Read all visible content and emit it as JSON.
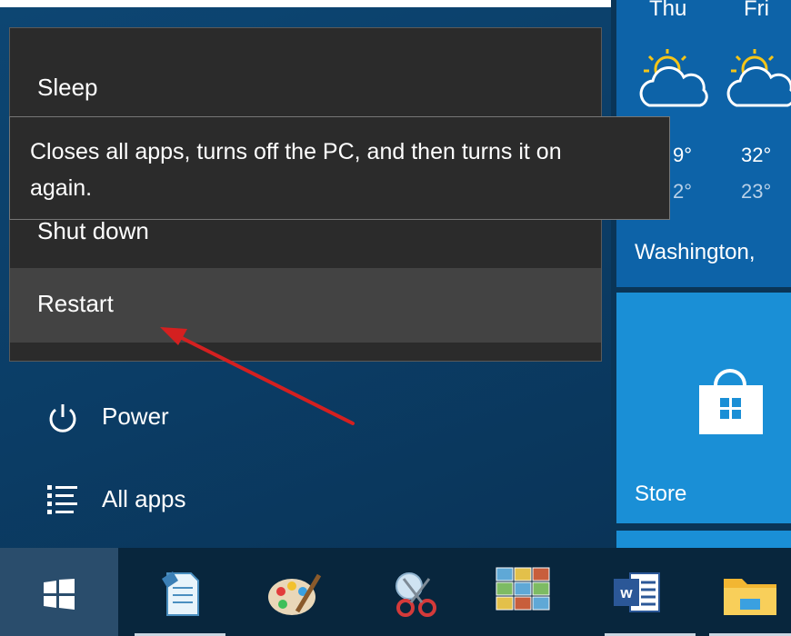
{
  "power_menu": {
    "items": [
      {
        "label": "Sleep"
      },
      {
        "label": "Shut down"
      },
      {
        "label": "Restart"
      }
    ]
  },
  "tooltip": {
    "line1": "Closes all apps, turns off the PC, and then turns it on",
    "line2": "again."
  },
  "left_pane": {
    "power_label": "Power",
    "all_apps_label": "All apps"
  },
  "weather": {
    "days": [
      {
        "name": "Thu",
        "high": "9°",
        "low": "2°",
        "icon": "partly-cloudy-icon"
      },
      {
        "name": "Fri",
        "high": "32°",
        "low": "23°",
        "icon": "partly-cloudy-icon"
      }
    ],
    "city": "Washington,"
  },
  "store": {
    "label": "Store"
  },
  "taskbar": {
    "items": [
      {
        "name": "start",
        "icon": "windows-logo-icon"
      },
      {
        "name": "notepad",
        "icon": "notepad-icon"
      },
      {
        "name": "paint",
        "icon": "paint-palette-icon"
      },
      {
        "name": "snipping-tool",
        "icon": "scissors-icon"
      },
      {
        "name": "photos",
        "icon": "photo-gallery-icon"
      },
      {
        "name": "word",
        "icon": "word-icon"
      },
      {
        "name": "file-explorer",
        "icon": "folder-icon"
      }
    ]
  },
  "colors": {
    "accent": "#1a8fd6",
    "menu_bg": "#2b2b2b",
    "menu_hover": "#434343",
    "arrow": "#d42020"
  }
}
